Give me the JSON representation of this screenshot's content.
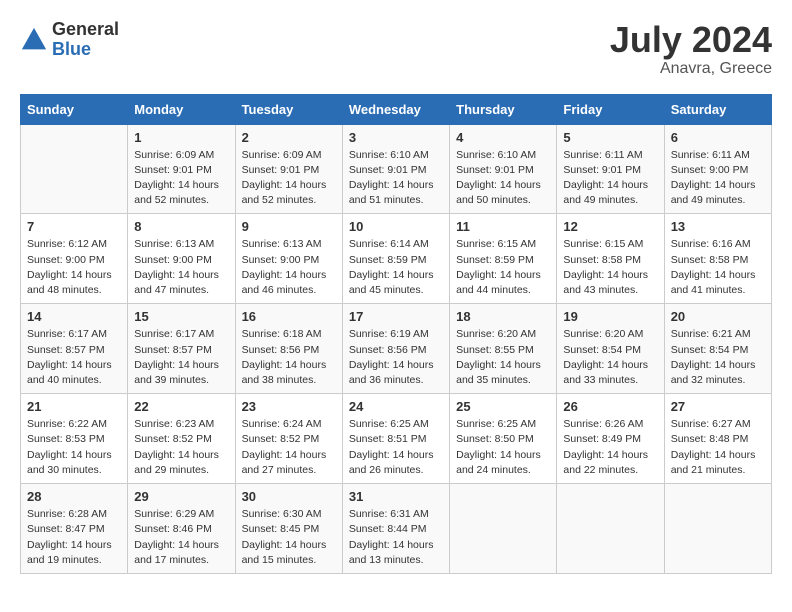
{
  "header": {
    "logo_general": "General",
    "logo_blue": "Blue",
    "month_year": "July 2024",
    "location": "Anavra, Greece"
  },
  "days_of_week": [
    "Sunday",
    "Monday",
    "Tuesday",
    "Wednesday",
    "Thursday",
    "Friday",
    "Saturday"
  ],
  "weeks": [
    [
      {
        "day": "",
        "info": ""
      },
      {
        "day": "1",
        "info": "Sunrise: 6:09 AM\nSunset: 9:01 PM\nDaylight: 14 hours\nand 52 minutes."
      },
      {
        "day": "2",
        "info": "Sunrise: 6:09 AM\nSunset: 9:01 PM\nDaylight: 14 hours\nand 52 minutes."
      },
      {
        "day": "3",
        "info": "Sunrise: 6:10 AM\nSunset: 9:01 PM\nDaylight: 14 hours\nand 51 minutes."
      },
      {
        "day": "4",
        "info": "Sunrise: 6:10 AM\nSunset: 9:01 PM\nDaylight: 14 hours\nand 50 minutes."
      },
      {
        "day": "5",
        "info": "Sunrise: 6:11 AM\nSunset: 9:01 PM\nDaylight: 14 hours\nand 49 minutes."
      },
      {
        "day": "6",
        "info": "Sunrise: 6:11 AM\nSunset: 9:00 PM\nDaylight: 14 hours\nand 49 minutes."
      }
    ],
    [
      {
        "day": "7",
        "info": "Sunrise: 6:12 AM\nSunset: 9:00 PM\nDaylight: 14 hours\nand 48 minutes."
      },
      {
        "day": "8",
        "info": "Sunrise: 6:13 AM\nSunset: 9:00 PM\nDaylight: 14 hours\nand 47 minutes."
      },
      {
        "day": "9",
        "info": "Sunrise: 6:13 AM\nSunset: 9:00 PM\nDaylight: 14 hours\nand 46 minutes."
      },
      {
        "day": "10",
        "info": "Sunrise: 6:14 AM\nSunset: 8:59 PM\nDaylight: 14 hours\nand 45 minutes."
      },
      {
        "day": "11",
        "info": "Sunrise: 6:15 AM\nSunset: 8:59 PM\nDaylight: 14 hours\nand 44 minutes."
      },
      {
        "day": "12",
        "info": "Sunrise: 6:15 AM\nSunset: 8:58 PM\nDaylight: 14 hours\nand 43 minutes."
      },
      {
        "day": "13",
        "info": "Sunrise: 6:16 AM\nSunset: 8:58 PM\nDaylight: 14 hours\nand 41 minutes."
      }
    ],
    [
      {
        "day": "14",
        "info": "Sunrise: 6:17 AM\nSunset: 8:57 PM\nDaylight: 14 hours\nand 40 minutes."
      },
      {
        "day": "15",
        "info": "Sunrise: 6:17 AM\nSunset: 8:57 PM\nDaylight: 14 hours\nand 39 minutes."
      },
      {
        "day": "16",
        "info": "Sunrise: 6:18 AM\nSunset: 8:56 PM\nDaylight: 14 hours\nand 38 minutes."
      },
      {
        "day": "17",
        "info": "Sunrise: 6:19 AM\nSunset: 8:56 PM\nDaylight: 14 hours\nand 36 minutes."
      },
      {
        "day": "18",
        "info": "Sunrise: 6:20 AM\nSunset: 8:55 PM\nDaylight: 14 hours\nand 35 minutes."
      },
      {
        "day": "19",
        "info": "Sunrise: 6:20 AM\nSunset: 8:54 PM\nDaylight: 14 hours\nand 33 minutes."
      },
      {
        "day": "20",
        "info": "Sunrise: 6:21 AM\nSunset: 8:54 PM\nDaylight: 14 hours\nand 32 minutes."
      }
    ],
    [
      {
        "day": "21",
        "info": "Sunrise: 6:22 AM\nSunset: 8:53 PM\nDaylight: 14 hours\nand 30 minutes."
      },
      {
        "day": "22",
        "info": "Sunrise: 6:23 AM\nSunset: 8:52 PM\nDaylight: 14 hours\nand 29 minutes."
      },
      {
        "day": "23",
        "info": "Sunrise: 6:24 AM\nSunset: 8:52 PM\nDaylight: 14 hours\nand 27 minutes."
      },
      {
        "day": "24",
        "info": "Sunrise: 6:25 AM\nSunset: 8:51 PM\nDaylight: 14 hours\nand 26 minutes."
      },
      {
        "day": "25",
        "info": "Sunrise: 6:25 AM\nSunset: 8:50 PM\nDaylight: 14 hours\nand 24 minutes."
      },
      {
        "day": "26",
        "info": "Sunrise: 6:26 AM\nSunset: 8:49 PM\nDaylight: 14 hours\nand 22 minutes."
      },
      {
        "day": "27",
        "info": "Sunrise: 6:27 AM\nSunset: 8:48 PM\nDaylight: 14 hours\nand 21 minutes."
      }
    ],
    [
      {
        "day": "28",
        "info": "Sunrise: 6:28 AM\nSunset: 8:47 PM\nDaylight: 14 hours\nand 19 minutes."
      },
      {
        "day": "29",
        "info": "Sunrise: 6:29 AM\nSunset: 8:46 PM\nDaylight: 14 hours\nand 17 minutes."
      },
      {
        "day": "30",
        "info": "Sunrise: 6:30 AM\nSunset: 8:45 PM\nDaylight: 14 hours\nand 15 minutes."
      },
      {
        "day": "31",
        "info": "Sunrise: 6:31 AM\nSunset: 8:44 PM\nDaylight: 14 hours\nand 13 minutes."
      },
      {
        "day": "",
        "info": ""
      },
      {
        "day": "",
        "info": ""
      },
      {
        "day": "",
        "info": ""
      }
    ]
  ]
}
